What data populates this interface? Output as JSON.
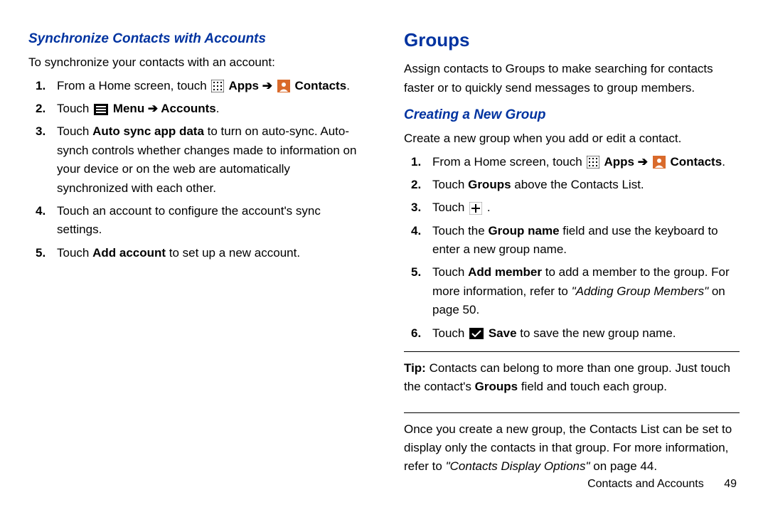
{
  "left": {
    "heading": "Synchronize Contacts with Accounts",
    "intro": "To synchronize your contacts with an account:",
    "steps": {
      "s1_a": "From a Home screen, touch ",
      "s1_b": " Apps ➔ ",
      "s1_c": " Contacts",
      "s1_d": ".",
      "s2_a": "Touch ",
      "s2_b": " Menu ➔ Accounts",
      "s2_c": ".",
      "s3_a": "Touch ",
      "s3_bold": "Auto sync app data",
      "s3_b": " to turn on auto-sync. Auto-synch controls whether changes made to information on your device or on the web are automatically synchronized with each other.",
      "s4": "Touch an account to configure the account's sync settings.",
      "s5_a": "Touch ",
      "s5_bold": "Add account",
      "s5_b": " to set up a new account."
    }
  },
  "right": {
    "heading": "Groups",
    "intro": "Assign contacts to Groups to make searching for contacts faster or to quickly send messages to group members.",
    "subheading": "Creating a New Group",
    "subintro": "Create a new group when you add or edit a contact.",
    "steps": {
      "s1_a": "From a Home screen, touch ",
      "s1_b": " Apps ➔ ",
      "s1_c": " Contacts",
      "s1_d": ".",
      "s2_a": "Touch ",
      "s2_bold": "Groups",
      "s2_b": " above the Contacts List.",
      "s3_a": "Touch ",
      "s3_b": " .",
      "s4_a": "Touch the ",
      "s4_bold": "Group name",
      "s4_b": " field and use the keyboard to enter a new group name.",
      "s5_a": "Touch ",
      "s5_bold": "Add member",
      "s5_b": " to add a member to the group. For more information, refer to ",
      "s5_ref": "\"Adding Group Members\"",
      "s5_c": " on page 50.",
      "s6_a": "Touch ",
      "s6_b": " ",
      "s6_bold": "Save",
      "s6_c": " to save the new group name."
    },
    "tip_label": "Tip:",
    "tip_a": " Contacts can belong to more than one group. Just touch the contact's ",
    "tip_bold": "Groups",
    "tip_b": " field and touch each group.",
    "after_a": "Once you create a new group, the Contacts List can be set to display only the contacts in that group. For more information, refer to ",
    "after_ref": "\"Contacts Display Options\"",
    "after_b": "  on page 44."
  },
  "footer": {
    "section": "Contacts and Accounts",
    "page": "49"
  }
}
